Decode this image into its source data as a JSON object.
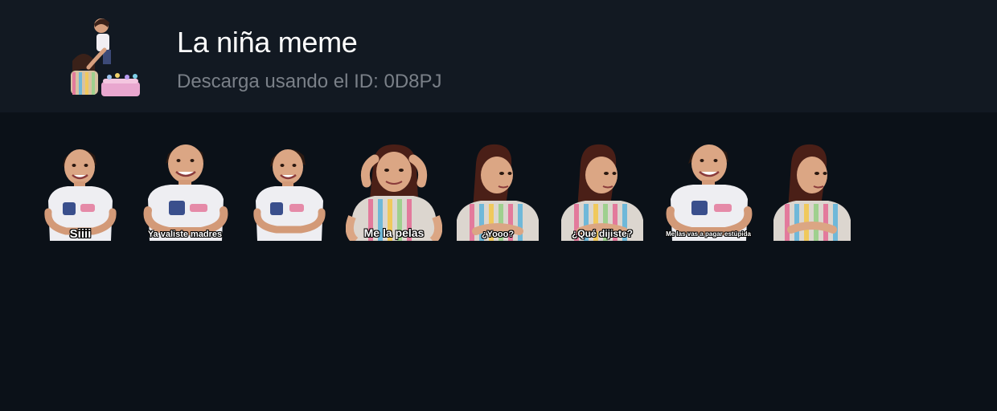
{
  "pack": {
    "title": "La niña meme",
    "subtitle": "Descarga usando el ID: 0D8PJ",
    "thumbnail": "girl-cake-thumbnail"
  },
  "stickers": [
    {
      "caption": "Siiii",
      "pose": "smile-front"
    },
    {
      "caption": "Ya valiste madres",
      "pose": "smile-front"
    },
    {
      "caption": "",
      "pose": "smile-front"
    },
    {
      "caption": "Me la pelas",
      "pose": "hands-on-head"
    },
    {
      "caption": "¿Yooo?",
      "pose": "side-look"
    },
    {
      "caption": "¿Qué dijiste?",
      "pose": "side-look"
    },
    {
      "caption": "Me las vas a pagar estúpida",
      "pose": "smile-front"
    },
    {
      "caption": "",
      "pose": "side-look"
    }
  ],
  "colors": {
    "header_bg": "#121922",
    "page_bg": "#0b1118",
    "title": "#ffffff",
    "subtitle": "#7a8088"
  }
}
